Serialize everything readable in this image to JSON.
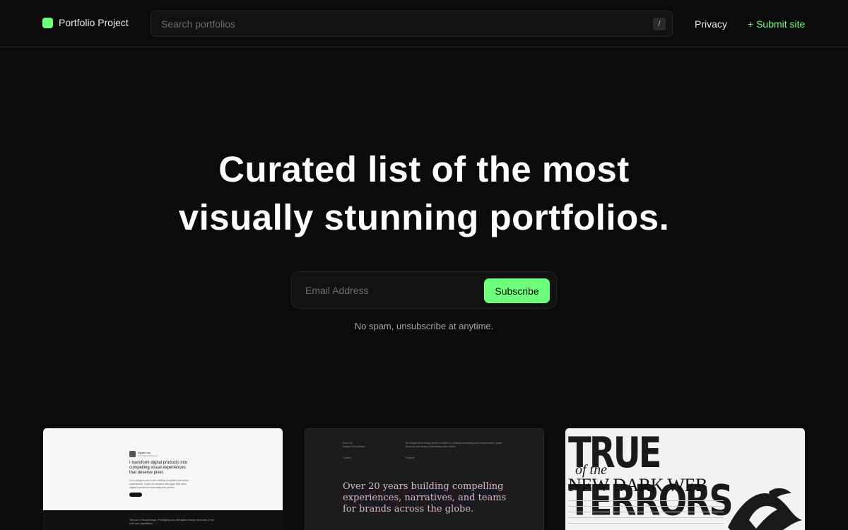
{
  "header": {
    "brand": "Portfolio Project",
    "search_placeholder": "Search portfolios",
    "search_shortcut": "/",
    "nav_privacy": "Privacy",
    "nav_submit": "+ Submit site"
  },
  "hero": {
    "title_line1": "Curated list of the most",
    "title_line2": "visually stunning portfolios.",
    "email_placeholder": "Email Address",
    "subscribe_label": "Subscribe",
    "note": "No spam, unsubscribe at anytime."
  },
  "cards": [
    {
      "name_line": "Agnes Inc.",
      "role_line": "UX Product Designer",
      "headline": "I transform digital products into compelling visual experiences that deserve pixel.",
      "body": "I'm a designer who loves crafting thoughtful interactive experiences. I work on complex web apps that need digital experiences that really feel perfect.",
      "dark_text": "Tell your 4 Visual Design, Prototyping and Interaction Design Summary of my work and capabilities."
    },
    {
      "col1": "Fran Ltd.",
      "col1b": "Design Consultancy",
      "col1c": "Contact",
      "col2": "An independent design studio focused on creating compelling brand experiences, digital products and lasting relationships with clients.",
      "col2b": "Projects",
      "headline": "Over 20 years building compelling experiences, narratives, and teams for brands across the globe."
    },
    {
      "title": "TRUE TERRORS",
      "of_the": "of the",
      "subtitle": "NEW DARK WEB"
    }
  ],
  "colors": {
    "accent": "#6dff7c",
    "background": "#0b0b0b",
    "card2_text": "#d7b7d4"
  }
}
